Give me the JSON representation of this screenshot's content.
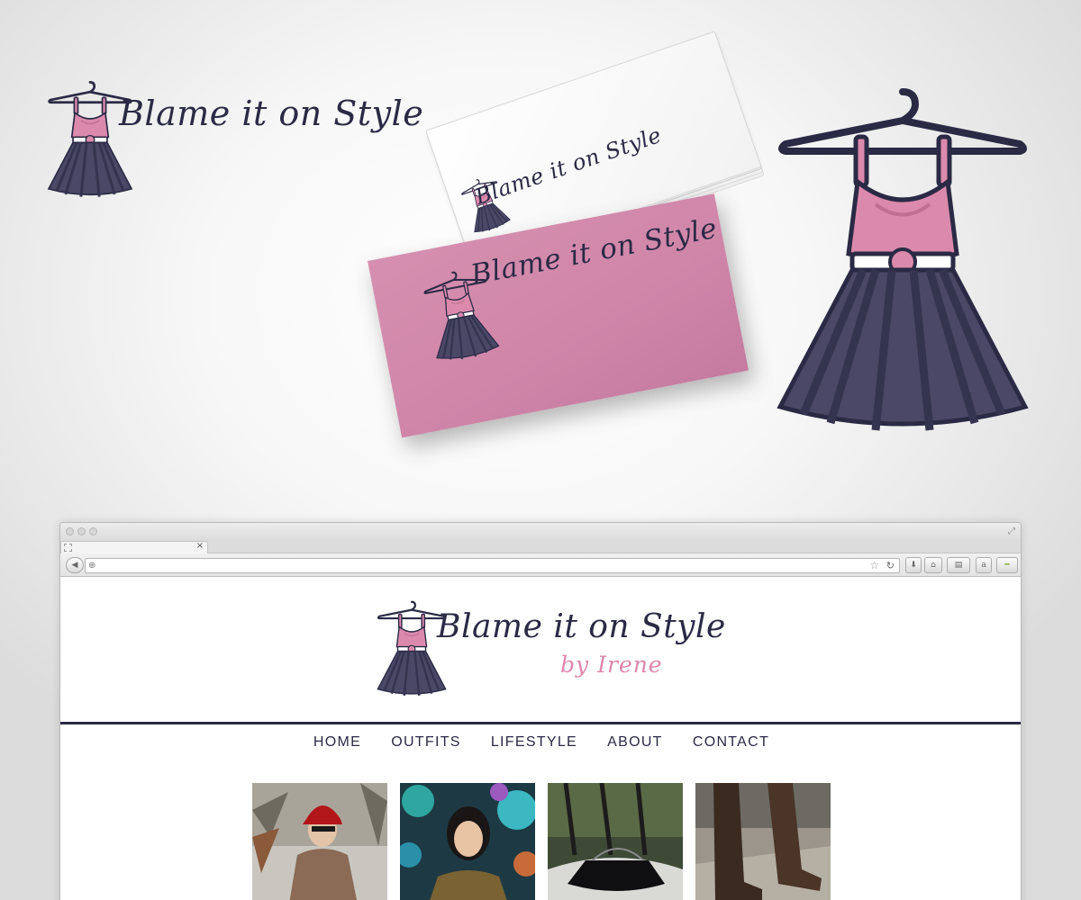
{
  "brand": {
    "name": "Blame it on Style",
    "byline": "by Irene",
    "colors": {
      "navy": "#2b2a45",
      "pink": "#de86ab",
      "card_pink": "#d68fb0",
      "skirt": "#4a4866",
      "bodice": "#db8aad"
    }
  },
  "browser": {
    "tab_close": "×",
    "url": "",
    "toolbar": {
      "back_icon": "◀",
      "globe_icon": "⊕",
      "star_icon": "☆",
      "reload_icon": "↻",
      "download_icon": "⬇",
      "home_icon": "⌂",
      "bookmarks_icon": "▤",
      "amazon_label": "a",
      "ext_icon": "━"
    }
  },
  "site": {
    "nav": [
      "HOME",
      "OUTFITS",
      "LIFESTYLE",
      "ABOUT",
      "CONTACT"
    ],
    "thumbnails": [
      {
        "subject": "woman in red cloche hat and brown coat"
      },
      {
        "subject": "woman in front of illuminated trees"
      },
      {
        "subject": "black patent handbag on white table"
      },
      {
        "subject": "brown leather boots on gravel"
      }
    ]
  }
}
